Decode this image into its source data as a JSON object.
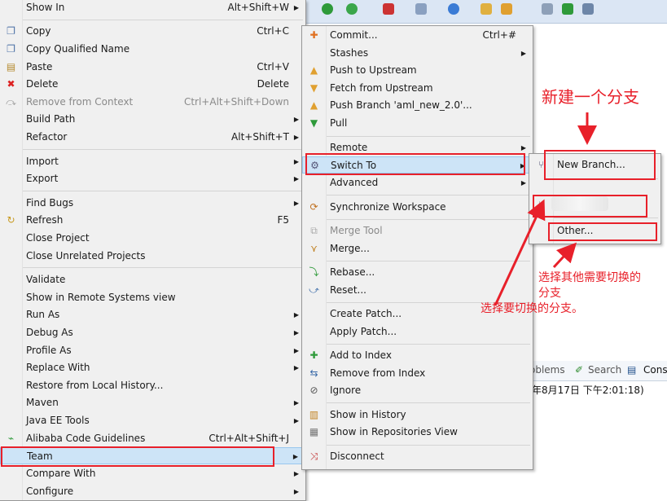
{
  "menu1": {
    "items": [
      {
        "label": "Show In",
        "shortcut": "Alt+Shift+W",
        "icon": "",
        "arrow": true
      },
      {
        "label": "Copy",
        "shortcut": "Ctrl+C",
        "icon": "copy-icon"
      },
      {
        "label": "Copy Qualified Name",
        "shortcut": "",
        "icon": "copy-qualified-icon"
      },
      {
        "label": "Paste",
        "shortcut": "Ctrl+V",
        "icon": "paste-icon"
      },
      {
        "label": "Delete",
        "shortcut": "Delete",
        "icon": "delete-icon"
      },
      {
        "label": "Remove from Context",
        "shortcut": "Ctrl+Alt+Shift+Down",
        "icon": "remove-context-icon",
        "disabled": true
      },
      {
        "label": "Build Path",
        "shortcut": "",
        "arrow": true
      },
      {
        "label": "Refactor",
        "shortcut": "Alt+Shift+T",
        "arrow": true
      },
      {
        "label": "Import",
        "arrow": true
      },
      {
        "label": "Export",
        "arrow": true
      },
      {
        "label": "Find Bugs",
        "arrow": true
      },
      {
        "label": "Refresh",
        "shortcut": "F5",
        "icon": "refresh-icon"
      },
      {
        "label": "Close Project"
      },
      {
        "label": "Close Unrelated Projects"
      },
      {
        "label": "Validate"
      },
      {
        "label": "Show in Remote Systems view"
      },
      {
        "label": "Run As",
        "arrow": true
      },
      {
        "label": "Debug As",
        "arrow": true
      },
      {
        "label": "Profile As",
        "arrow": true
      },
      {
        "label": "Replace With",
        "arrow": true
      },
      {
        "label": "Restore from Local History..."
      },
      {
        "label": "Maven",
        "arrow": true
      },
      {
        "label": "Java EE Tools",
        "arrow": true
      },
      {
        "label": "Alibaba Code Guidelines",
        "shortcut": "Ctrl+Alt+Shift+J",
        "icon": "alibaba-icon"
      },
      {
        "label": "Team",
        "arrow": true,
        "highlighted": true
      },
      {
        "label": "Compare With",
        "arrow": true
      },
      {
        "label": "Configure",
        "arrow": true
      }
    ]
  },
  "menu2": {
    "items": [
      {
        "label": "Commit...",
        "shortcut": "Ctrl+#",
        "icon": "commit-icon"
      },
      {
        "label": "Stashes",
        "arrow": true
      },
      {
        "label": "Push to Upstream",
        "icon": "push-icon"
      },
      {
        "label": "Fetch from Upstream",
        "icon": "fetch-icon"
      },
      {
        "label": "Push Branch 'aml_new_2.0'...",
        "icon": "push-branch-icon"
      },
      {
        "label": "Pull",
        "icon": "pull-icon"
      },
      {
        "label": "Remote",
        "arrow": true
      },
      {
        "label": "Switch To",
        "arrow": true,
        "icon": "switch-icon",
        "highlighted": true
      },
      {
        "label": "Advanced",
        "arrow": true
      },
      {
        "label": "Synchronize Workspace",
        "icon": "sync-icon"
      },
      {
        "label": "Merge Tool",
        "icon": "merge-tool-icon",
        "disabled": true
      },
      {
        "label": "Merge...",
        "icon": "merge-icon"
      },
      {
        "label": "Rebase...",
        "icon": "rebase-icon"
      },
      {
        "label": "Reset...",
        "icon": "reset-icon"
      },
      {
        "label": "Create Patch..."
      },
      {
        "label": "Apply Patch..."
      },
      {
        "label": "Add to Index",
        "icon": "add-index-icon"
      },
      {
        "label": "Remove from Index",
        "icon": "remove-index-icon"
      },
      {
        "label": "Ignore",
        "icon": "ignore-icon"
      },
      {
        "label": "Show in History",
        "icon": "history-icon"
      },
      {
        "label": "Show in Repositories View",
        "icon": "repositories-icon"
      },
      {
        "label": "Disconnect",
        "icon": "disconnect-icon"
      }
    ]
  },
  "menu3": {
    "items": [
      {
        "label": "New Branch...",
        "icon": "new-branch-icon"
      },
      {
        "label": "",
        "icon": "branch-icon",
        "blurred": true
      },
      {
        "label": "Other..."
      }
    ]
  },
  "console": {
    "tabs": [
      "oblems",
      "Search",
      "Cons"
    ],
    "line": "年8月17日 下午2:01:18)"
  },
  "annotations": {
    "new_branch": "新建一个分支",
    "select_branch": "选择要切换的分支。",
    "select_other_line1": "选择其他需要切换的",
    "select_other_line2": "分支"
  },
  "colors": {
    "accent_red": "#e8202a",
    "highlight": "#cde4f7",
    "menu_bg": "#f0f0f0"
  }
}
